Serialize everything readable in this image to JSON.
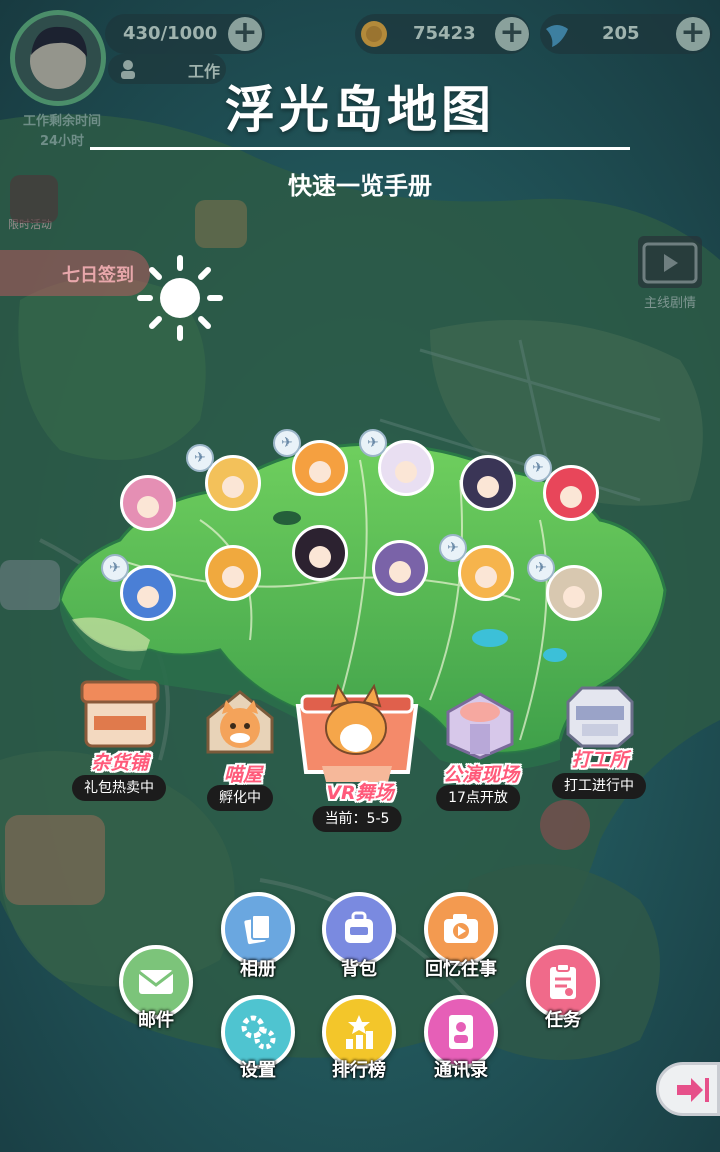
{
  "player": {
    "stamina": "430/1000",
    "status_label": "工作",
    "side_text_1": "工作剩余时间",
    "side_text_2": "24小时"
  },
  "currency": {
    "coins": "75423",
    "gems": "205"
  },
  "left_banner": {
    "label": "七日签到",
    "sub_label": "限时活动"
  },
  "right_widget": {
    "label": "主线剧情"
  },
  "overlay": {
    "title": "浮光岛地图",
    "subtitle": "快速一览手册"
  },
  "buildings": [
    {
      "name": "杂货铺",
      "status": "礼包热卖中"
    },
    {
      "name": "喵屋",
      "status": "孵化中"
    },
    {
      "name": "VR舞场",
      "status": "当前：5-5"
    },
    {
      "name": "公演现场",
      "status": "17点开放"
    },
    {
      "name": "打工所",
      "status": "打工进行中"
    }
  ],
  "menu": {
    "album": "相册",
    "backpack": "背包",
    "memories": "回忆往事",
    "mail": "邮件",
    "tasks": "任务",
    "settings": "设置",
    "ranking": "排行榜",
    "contacts": "通讯录"
  },
  "characters": [
    {
      "icon": "pink-hair-girl-icon",
      "color": "#e58fb4"
    },
    {
      "icon": "blonde-fox-girl-icon",
      "color": "#f3c15a"
    },
    {
      "icon": "orange-hair-girl-icon",
      "color": "#f5a040"
    },
    {
      "icon": "white-hair-girl-icon",
      "color": "#e9dff2"
    },
    {
      "icon": "dark-creature-icon",
      "color": "#3a3556"
    },
    {
      "icon": "red-hair-girl-icon",
      "color": "#e8465a"
    },
    {
      "icon": "blue-hair-girl-icon",
      "color": "#4a7fd6"
    },
    {
      "icon": "witch-hat-girl-icon",
      "color": "#f0a93e"
    },
    {
      "icon": "dark-hair-girl-icon",
      "color": "#2c2230"
    },
    {
      "icon": "purple-hair-girl-icon",
      "color": "#7a63a8"
    },
    {
      "icon": "fox-ear-girl-icon",
      "color": "#f6b44c"
    },
    {
      "icon": "silver-hair-boy-icon",
      "color": "#d8c8b0"
    }
  ]
}
